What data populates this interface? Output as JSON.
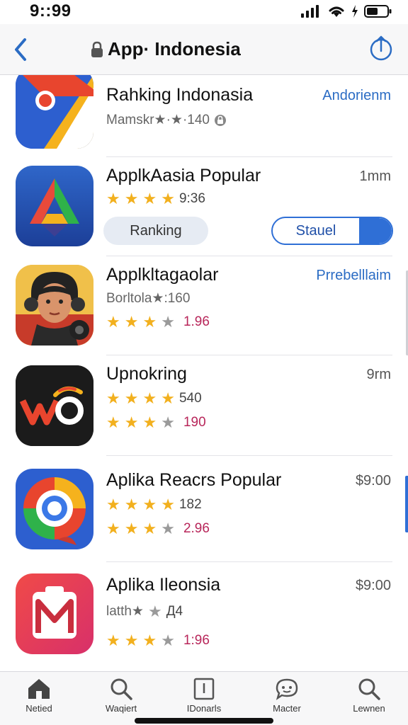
{
  "status_bar": {
    "time": "9::99"
  },
  "nav": {
    "title": "App· Indonesia"
  },
  "apps": [
    {
      "name": "Rahking Indonasia",
      "side": "Andorienm",
      "meta_text": "Mamskr★·★·140"
    },
    {
      "name": "ApplkAasia Popular",
      "side": "1mm",
      "rating_value": "9:36",
      "btn_left": "Ranking",
      "btn_right": "Stauel"
    },
    {
      "name": "Applkltagaolar",
      "side": "Prrebelllaim",
      "meta_text": "Borltola★:160",
      "rating_value": "1.96"
    },
    {
      "name": "Upnokring",
      "side": "9rm",
      "rating_value_1": "540",
      "rating_value_2": "190"
    },
    {
      "name": "Aplika Reacrs Popular",
      "side": "$9:00",
      "rating_value_1": "182",
      "rating_value_2": "2.96"
    },
    {
      "name": "Aplika Ileonsia",
      "side": "$9:00",
      "meta_text": "latth★ ",
      "meta_num": "Д4",
      "rating_value": "1:96"
    }
  ],
  "tabs": [
    {
      "label": "Netied",
      "icon": "house-icon"
    },
    {
      "label": "Waqiert",
      "icon": "search-icon"
    },
    {
      "label": "IDonarls",
      "icon": "document-icon"
    },
    {
      "label": "Macter",
      "icon": "chat-icon"
    },
    {
      "label": "Lewnen",
      "icon": "search-icon"
    }
  ],
  "colors": {
    "accent": "#2f6fd6",
    "star": "#f2b01e",
    "link": "#2b6cc4",
    "rating_red": "#b8265a"
  }
}
